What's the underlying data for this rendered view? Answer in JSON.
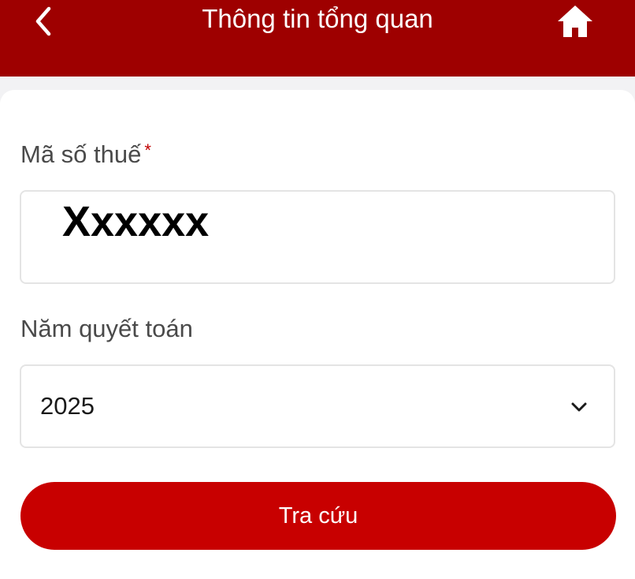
{
  "header": {
    "title": "Thông tin tổng quan",
    "back_icon": "chevron-left-icon",
    "home_icon": "home-icon",
    "background": "#9e0000"
  },
  "form": {
    "tax_code": {
      "label": "Mã số thuế",
      "required_mark": "*",
      "value": "Xxxxxx"
    },
    "settlement_year": {
      "label": "Năm quyết toán",
      "selected": "2025",
      "icon": "chevron-down-icon"
    },
    "submit_label": "Tra cứu",
    "accent": "#c80000"
  }
}
